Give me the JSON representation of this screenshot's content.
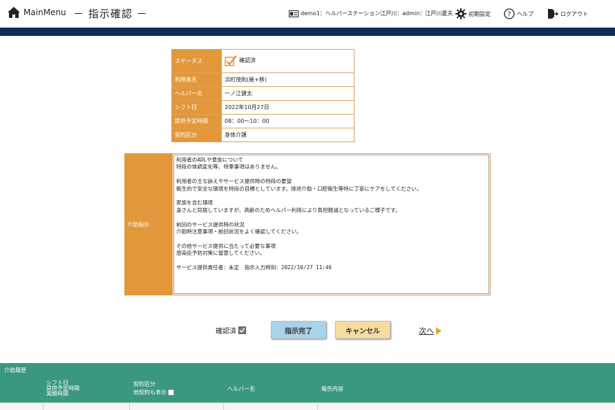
{
  "header": {
    "home_label": "MainMenu",
    "page_title": "－ 指示確認 －",
    "user_info": "demo1：ヘルパーステーション江戸川：admin：江戸川夏夫",
    "settings_label": "初期設定",
    "help_label": "ヘルプ",
    "logout_label": "ログアウト",
    "nav_color": "#0d2e57"
  },
  "info": {
    "status_label": "ステータス",
    "status_value": "確認済",
    "user_label": "利用者名",
    "user_value": "浜町茂則(屋+移)",
    "helper_label": "ヘルパー名",
    "helper_value": "一ノ江健太",
    "shift_label": "シフト日",
    "shift_value": "2022年10月27日",
    "time_label": "提供予定時間",
    "time_value": "08：00～10：00",
    "contract_label": "契約区分",
    "contract_value": "身体介護"
  },
  "instruction": {
    "label": "介助指示",
    "text": "利用者のADLや意欲について\n特段の体調変化等、特筆事項はありません。\n\n利用者の主な訴えやサービス提供時の特段の要望\n衛生的で安全な環境を特段の目標としています。排泄介助・口腔衛生等特に丁寧にケアをしてください。\n\n家族を含む環境\n身さんと同居していますが、高齢のためヘルパー利用により負担軽減となっているご様子です。\n\n前回のサービス提供時の状況\n介助時注意事項・前回状況をよく確認してください。\n\nその他サービス提供に当たって必要な事項\n感染症予防対策に留意してください。\n\nサービス提供責任者：未定　指示入力時刻：2022/10/27 11:46"
  },
  "actions": {
    "confirm_label": "確認済",
    "done_label": "指示完了",
    "cancel_label": "キャンセル",
    "next_label": "次へ"
  },
  "history": {
    "title": "介助履歴",
    "col_shift": "シフト日",
    "col_planned": "提供予定時間",
    "col_actual": "実績時間",
    "col_contract": "契約区分",
    "col_show_cancel": "他契約も表示",
    "col_helper": "ヘルパー名",
    "col_report": "報告内容",
    "bg_color": "#3a9880"
  }
}
